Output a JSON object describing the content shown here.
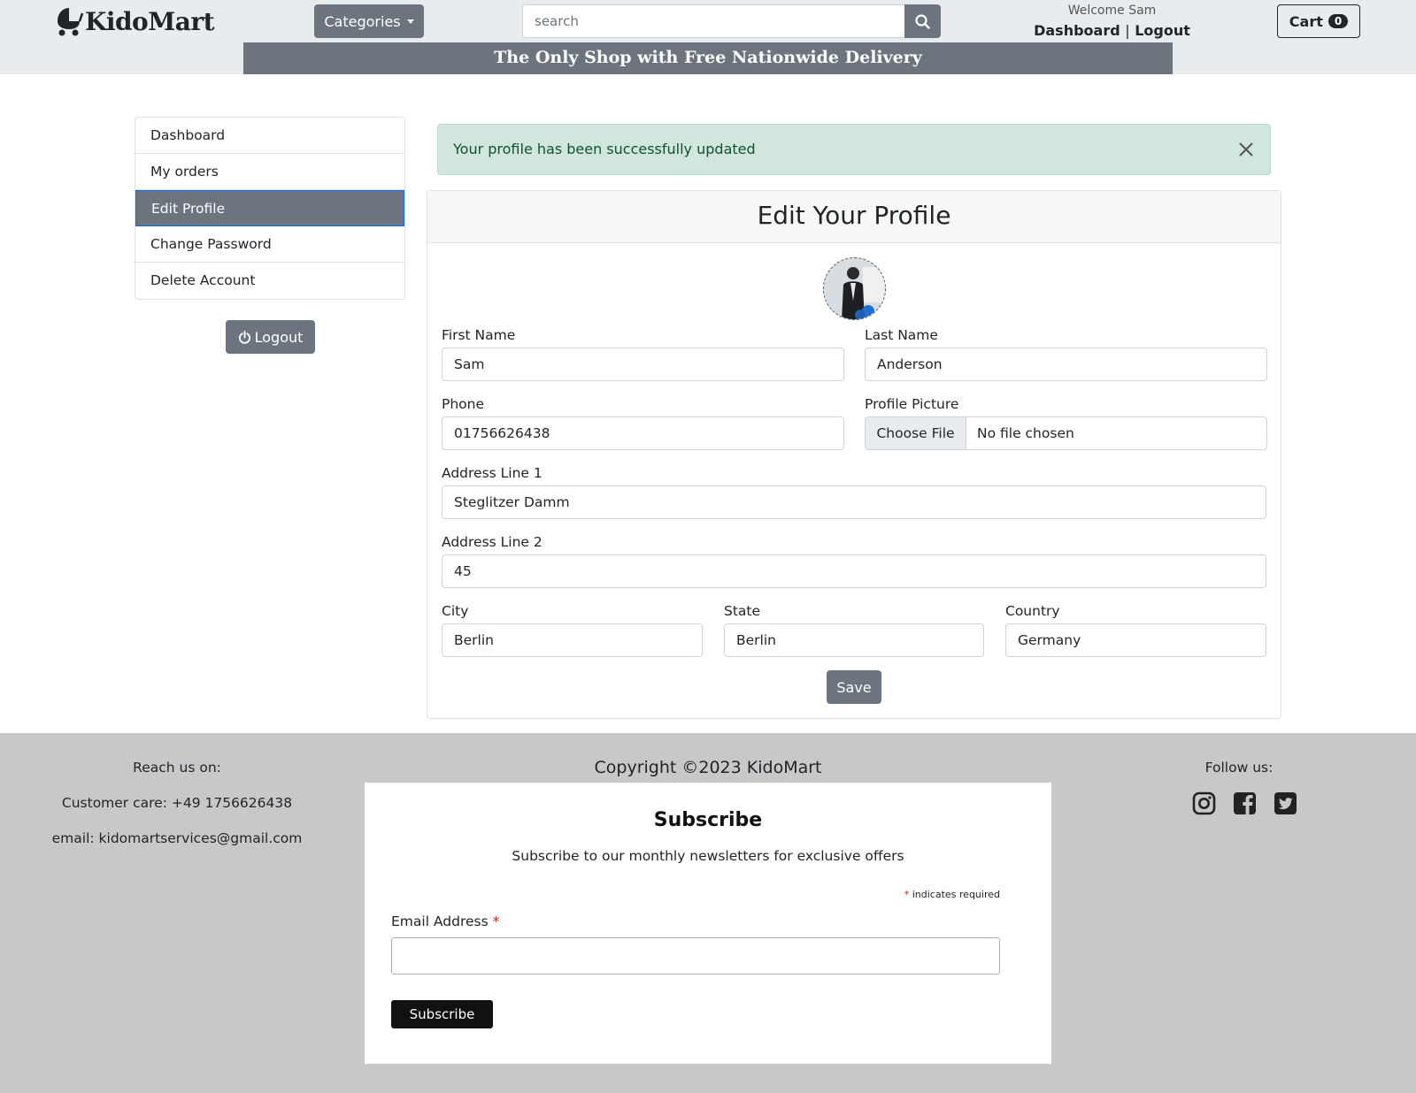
{
  "header": {
    "logo_text": "KidoMart",
    "categories_label": "Categories",
    "search_placeholder": "search",
    "welcome_text": "Welcome Sam",
    "dashboard_link": "Dashboard",
    "separator": "|",
    "logout_link": "Logout",
    "cart_label": "Cart",
    "cart_count": "0",
    "banner_text": "The Only Shop with Free Nationwide Delivery"
  },
  "sidebar": {
    "items": [
      {
        "label": "Dashboard"
      },
      {
        "label": "My orders"
      },
      {
        "label": "Edit Profile",
        "active": true
      },
      {
        "label": "Change Password"
      },
      {
        "label": "Delete Account"
      }
    ],
    "logout_label": "Logout"
  },
  "alert": {
    "message": "Your profile has been successfully updated"
  },
  "form": {
    "title": "Edit Your Profile",
    "first_name": {
      "label": "First Name",
      "value": "Sam"
    },
    "last_name": {
      "label": "Last Name",
      "value": "Anderson"
    },
    "phone": {
      "label": "Phone",
      "value": "01756626438"
    },
    "profile_picture": {
      "label": "Profile Picture",
      "button": "Choose File",
      "status": "No file chosen"
    },
    "address1": {
      "label": "Address Line 1",
      "value": "Steglitzer Damm"
    },
    "address2": {
      "label": "Address Line 2",
      "value": "45"
    },
    "city": {
      "label": "City",
      "value": "Berlin"
    },
    "state": {
      "label": "State",
      "value": "Berlin"
    },
    "country": {
      "label": "Country",
      "value": "Germany"
    },
    "save_label": "Save"
  },
  "footer": {
    "reach_us": "Reach us on:",
    "customer_care": "Customer care: +49 1756626438",
    "email_prefix": "email:",
    "email": "kidomartservices@gmail.com",
    "copyright": "Copyright ©2023 KidoMart",
    "follow_us": "Follow us:",
    "social_icons": [
      "instagram-icon",
      "facebook-icon",
      "twitter-icon"
    ]
  },
  "subscribe": {
    "title": "Subscribe",
    "description": "Subscribe to our monthly newsletters for exclusive offers",
    "required_note": "indicates required",
    "asterisk": "*",
    "email_label": "Email Address",
    "button_label": "Subscribe"
  },
  "colors": {
    "header_bg": "#e9ecef",
    "secondary": "#6c757d",
    "alert_bg": "#d1e7dd",
    "alert_text": "#0f5132",
    "footer_bg": "#c8c8c8"
  }
}
